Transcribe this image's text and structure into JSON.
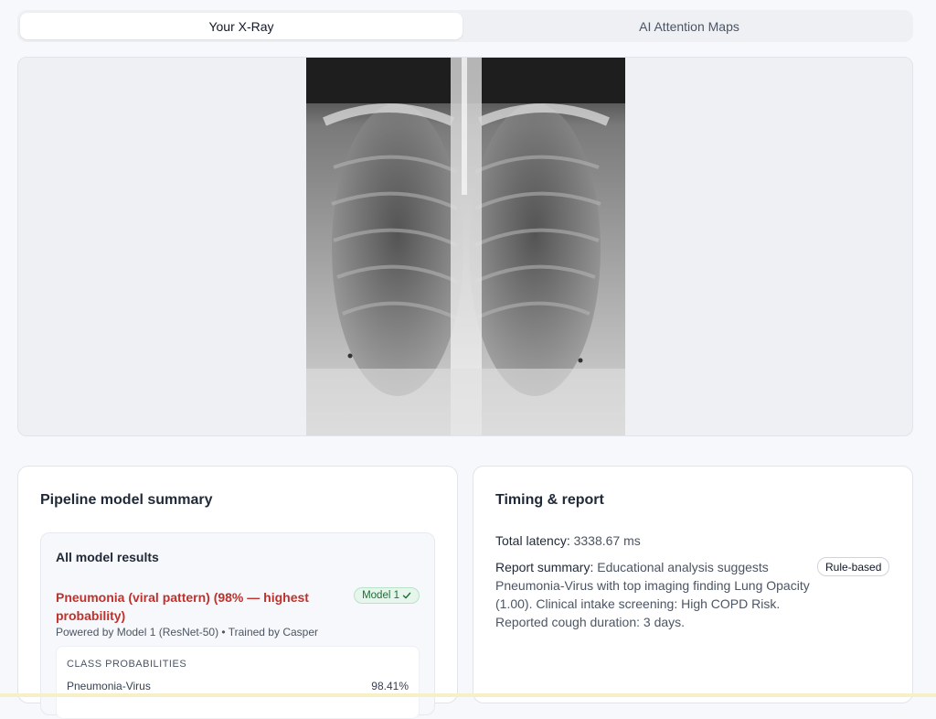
{
  "tabs": {
    "your_xray": "Your X-Ray",
    "attention_maps": "AI Attention Maps"
  },
  "pipeline": {
    "title": "Pipeline model summary",
    "all_results_title": "All model results",
    "result_title": "Pneumonia (viral pattern) (98% — highest probability)",
    "model_badge": "Model 1",
    "powered_by": "Powered by Model 1 (ResNet-50) • Trained by Casper",
    "class_probabilities_header": "CLASS PROBABILITIES",
    "probabilities": [
      {
        "label": "Pneumonia-Virus",
        "value": "98.41%"
      }
    ]
  },
  "timing": {
    "title": "Timing & report",
    "latency_label": "Total latency:",
    "latency_value": "3338.67 ms",
    "summary_label": "Report summary:",
    "summary_text": "Educational analysis suggests Pneumonia-Virus with top imaging finding Lung Opacity (1.00). Clinical intake screening: High COPD Risk. Reported cough duration: 3 days.",
    "rule_badge": "Rule-based"
  },
  "colors": {
    "accent_red": "#c0312b",
    "badge_green": "#1f6b38"
  },
  "icons": {
    "model_badge_check": "check-icon"
  }
}
